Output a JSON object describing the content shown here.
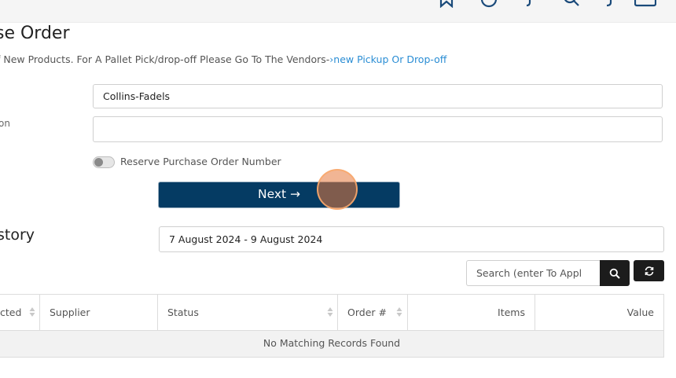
{
  "page": {
    "title": "se Order",
    "intro_text": "f New Products. For A Pallet Pick/drop-off Please Go To The Vendors-",
    "intro_link": "new Pickup Or Drop-off"
  },
  "form": {
    "label_description": "on",
    "vendor_value": "Collins-Fadels",
    "second_value": "",
    "reserve_toggle_label": "Reserve Purchase Order Number",
    "reserve_toggle_on": false,
    "next_button_label": "Next →"
  },
  "history": {
    "title": "story",
    "date_range": "7 August 2024 - 9 August 2024",
    "search_placeholder": "Search (enter To Appl",
    "table": {
      "columns": [
        "cted",
        "Supplier",
        "Status",
        "Order #",
        "Items",
        "Value"
      ],
      "empty_message": "No Matching Records Found"
    }
  },
  "icons": [
    "bookmark-icon",
    "help-circle-icon",
    "notification-icon",
    "search-icon",
    "phone-icon",
    "menu-icon",
    "sort-icon",
    "refresh-icon"
  ],
  "colors": {
    "primary_button": "#053b63",
    "link": "#2a8dd4",
    "dark_button": "#1c1c1c",
    "cursor_highlight": "#e6783c"
  }
}
